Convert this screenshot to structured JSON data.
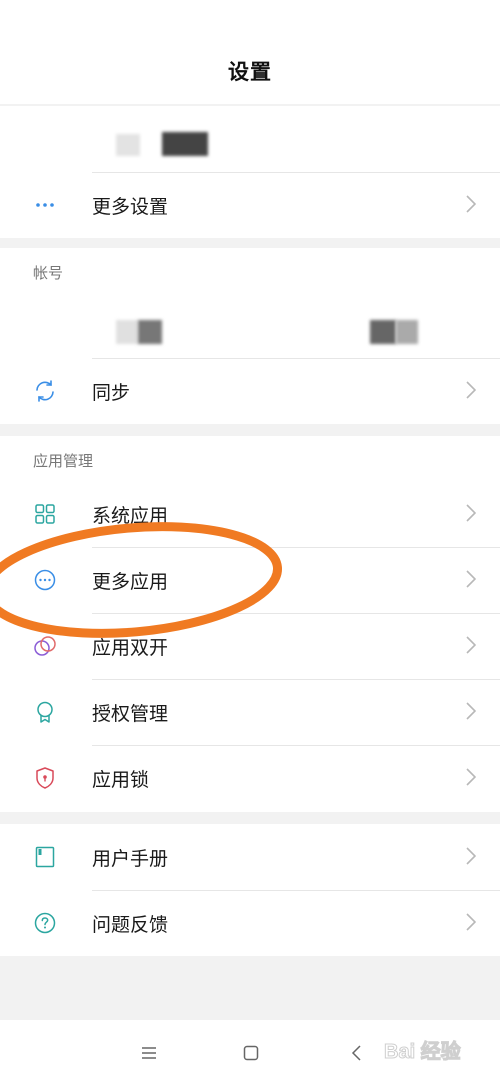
{
  "header": {
    "title": "设置"
  },
  "colors": {
    "accent_blue": "#3a8ee6",
    "accent_teal": "#2ba6a0",
    "lock_red": "#d94a5a",
    "annotation_orange": "#f07a22",
    "chevron": "#b8b8b8"
  },
  "sections": {
    "top": {
      "rows": [
        {
          "label": "更多设置",
          "icon": "more-dots-icon"
        }
      ]
    },
    "account": {
      "label": "帐号",
      "rows": [
        {
          "label": "同步",
          "icon": "sync-icon"
        }
      ]
    },
    "apps": {
      "label": "应用管理",
      "rows": [
        {
          "label": "系统应用",
          "icon": "grid-icon"
        },
        {
          "label": "更多应用",
          "icon": "more-circle-icon"
        },
        {
          "label": "应用双开",
          "icon": "dual-app-icon"
        },
        {
          "label": "授权管理",
          "icon": "authorization-icon"
        },
        {
          "label": "应用锁",
          "icon": "shield-lock-icon"
        }
      ]
    },
    "help": {
      "rows": [
        {
          "label": "用户手册",
          "icon": "manual-book-icon"
        },
        {
          "label": "问题反馈",
          "icon": "question-circle-icon"
        }
      ]
    }
  },
  "navbar": {
    "buttons": [
      "menu-icon",
      "home-square-icon",
      "back-chevron-icon"
    ]
  },
  "watermark": {
    "text": "Bai 经验"
  }
}
